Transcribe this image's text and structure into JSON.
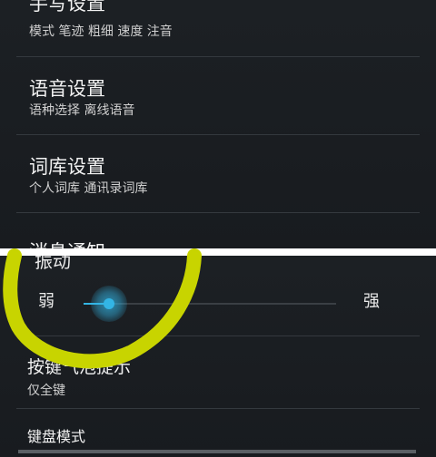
{
  "top": {
    "items": [
      {
        "title": "手写设置",
        "subtitle": "模式 笔迹 粗细 速度 注音"
      },
      {
        "title": "语音设置",
        "subtitle": "语种选择 离线语音"
      },
      {
        "title": "词库设置",
        "subtitle": "个人词库 通讯录词库"
      },
      {
        "title": "消息通知"
      }
    ]
  },
  "bottom": {
    "vibration": {
      "title": "振动",
      "low_label": "弱",
      "high_label": "强",
      "level": 0.1,
      "accent": "#33b5e5"
    },
    "key_popup": {
      "title": "按键气泡提示",
      "subtitle": "仅全键"
    },
    "keyboard_mode": {
      "title": "键盘模式"
    }
  },
  "colors": {
    "background": "#1a1d21",
    "annotation": "#c8d400"
  }
}
